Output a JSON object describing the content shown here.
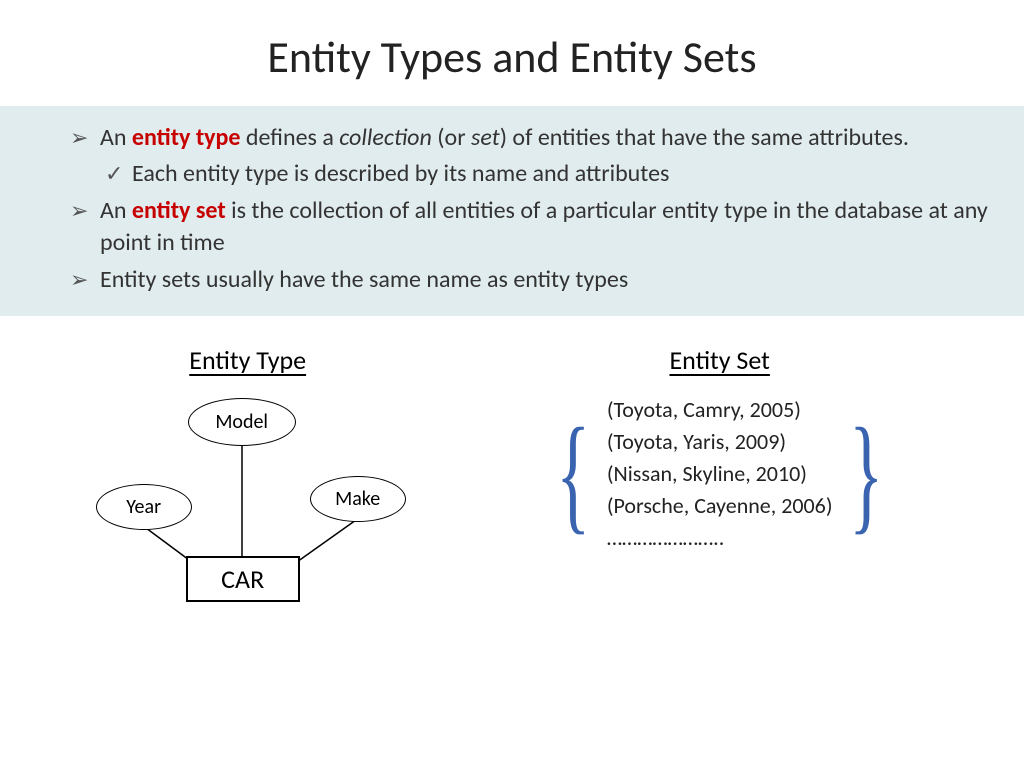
{
  "title": "Entity Types and Entity Sets",
  "bullets": {
    "b1_pre": "An ",
    "b1_term": "entity type",
    "b1_mid": " defines a ",
    "b1_it1": "collection",
    "b1_mid2": " (or ",
    "b1_it2": "set",
    "b1_post": ") of entities that have the same attributes.",
    "sub1": "Each entity type is described by its name and attributes",
    "b2_pre": "An ",
    "b2_term": "entity set",
    "b2_post": " is the collection of all entities of a particular entity type in the database at any point in time",
    "b3": "Entity sets usually have the same name as entity types"
  },
  "cols": {
    "left": "Entity Type",
    "right": "Entity Set"
  },
  "er": {
    "model": "Model",
    "year": "Year",
    "make": "Make",
    "car": "CAR"
  },
  "braces": {
    "open": "{",
    "close": "}"
  },
  "set": {
    "r1": "(Toyota, Camry, 2005)",
    "r2": "(Toyota, Yaris, 2009)",
    "r3": "(Nissan, Skyline, 2010)",
    "r4": "(Porsche, Cayenne, 2006)",
    "r5": "………………….."
  }
}
